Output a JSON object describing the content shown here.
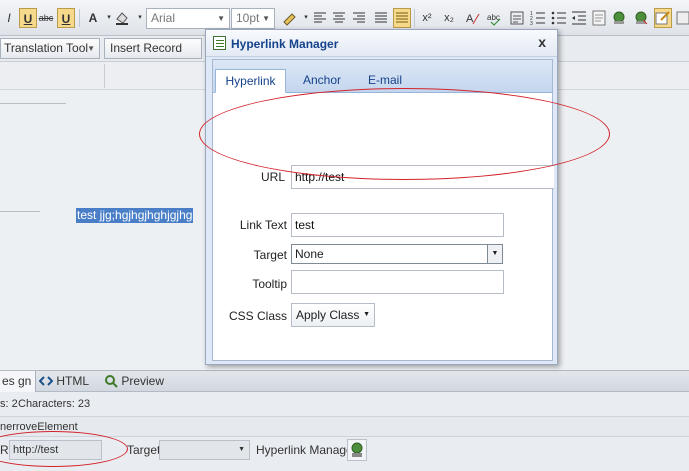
{
  "toolbar": {
    "font_name": "Arial",
    "font_size": "10pt",
    "buttons": {
      "italic": "I",
      "underline": "U",
      "strike": "abc",
      "underline2": "U",
      "font_color": "A",
      "superscript": "x²",
      "subscript": "x₂"
    }
  },
  "toolbar2": {
    "translation_tool": "Translation Tool",
    "insert_record_field": "Insert Record Field"
  },
  "content": {
    "selected_text": "test jjg;hgjhgjhghjgjhg"
  },
  "dialog": {
    "title": "Hyperlink Manager",
    "close": "x",
    "tabs": [
      "Hyperlink",
      "Anchor",
      "E-mail"
    ],
    "fields": {
      "url_label": "URL",
      "url_value": "http://test",
      "link_text_label": "Link Text",
      "link_text_value": "test",
      "target_label": "Target",
      "target_value": "None",
      "tooltip_label": "Tooltip",
      "tooltip_value": "",
      "css_class_label": "CSS Class",
      "css_class_value": "Apply Class"
    }
  },
  "modes": {
    "design": "es gn",
    "html": "HTML",
    "preview": "Preview"
  },
  "status": {
    "words": "s: 2",
    "characters": "Characters: 23",
    "element": "nerroveElement"
  },
  "properties": {
    "url_label": "RL",
    "url_value": "http://test",
    "target_label": "Target",
    "target_value": "",
    "manager_label": "Hyperlink Manager"
  },
  "colors": {
    "accent": "#15428b",
    "highlight": "#4a7fc7",
    "annotation": "#d2232a"
  }
}
